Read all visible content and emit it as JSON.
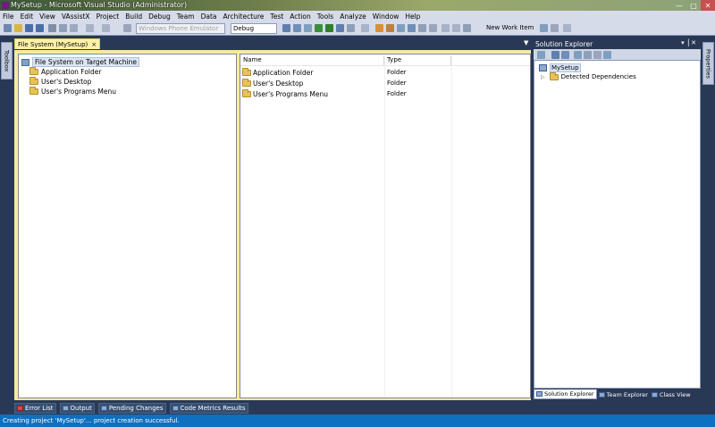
{
  "window": {
    "title": "MySetup - Microsoft Visual Studio (Administrator)"
  },
  "menu": [
    "File",
    "Edit",
    "View",
    "VAssistX",
    "Project",
    "Build",
    "Debug",
    "Team",
    "Data",
    "Architecture",
    "Test",
    "Action",
    "Tools",
    "Analyze",
    "Window",
    "Help"
  ],
  "toolbar": {
    "platform_value": "Windows Phone Emulator",
    "config_value": "Debug",
    "new_work_item_label": "New Work Item"
  },
  "side": {
    "toolbox_label": "Toolbox",
    "properties_label": "Properties"
  },
  "doc_tab": {
    "label": "File System (MySetup)",
    "close": "×"
  },
  "tree": {
    "root": "File System on Target Machine",
    "items": [
      "Application Folder",
      "User's Desktop",
      "User's Programs Menu"
    ]
  },
  "list": {
    "columns": [
      "Name",
      "Type"
    ],
    "rows": [
      {
        "name": "Application Folder",
        "type": "Folder"
      },
      {
        "name": "User's Desktop",
        "type": "Folder"
      },
      {
        "name": "User's Programs Menu",
        "type": "Folder"
      }
    ]
  },
  "solution_explorer": {
    "title": "Solution Explorer",
    "project": "MySetup",
    "child": "Detected Dependencies",
    "tabs": [
      "Solution Explorer",
      "Team Explorer",
      "Class View"
    ]
  },
  "bottom_tabs": [
    "Error List",
    "Output",
    "Pending Changes",
    "Code Metrics Results"
  ],
  "status": {
    "text": "Creating project 'MySetup'... project creation successful."
  }
}
